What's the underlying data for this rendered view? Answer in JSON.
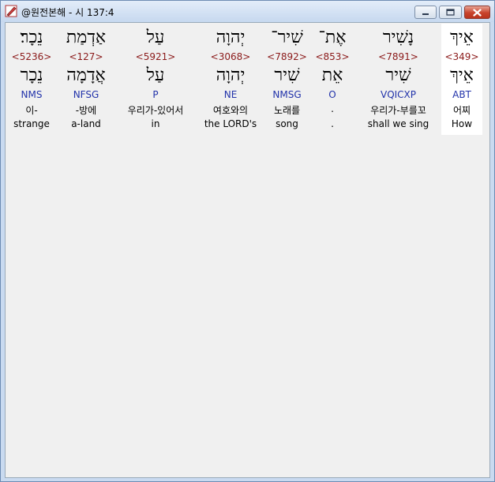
{
  "window": {
    "title": "@원전본해 - 시 137:4",
    "icon": "app-pen-icon"
  },
  "colors": {
    "strong": "#8b1a1a",
    "parse": "#2233aa",
    "selected_bg": "#ffffff",
    "panel_bg": "#f0f0f0"
  },
  "words": [
    {
      "hebrew": "נֵכָר׃",
      "strong": "<5236>",
      "lemma": "נֵכָר",
      "parse": "NMS",
      "korean": "이-",
      "english": "strange"
    },
    {
      "hebrew": "אַדְמַת",
      "strong": "<127>",
      "lemma": "אֲדָמָה",
      "parse": "NFSG",
      "korean": "-방에",
      "english": "a-land"
    },
    {
      "hebrew": "עַל",
      "strong": "<5921>",
      "lemma": "עַל",
      "parse": "P",
      "korean": "우리가-있어서",
      "english": "in"
    },
    {
      "hebrew": "יְהוָה",
      "strong": "<3068>",
      "lemma": "יְהוָה",
      "parse": "NE",
      "korean": "여호와의",
      "english": "the LORD's"
    },
    {
      "hebrew": "שִׁיר־",
      "strong": "<7892>",
      "lemma": "שִׁיר",
      "parse": "NMSG",
      "korean": "노래를",
      "english": "song"
    },
    {
      "hebrew": "אֶת־",
      "strong": "<853>",
      "lemma": "אֵת",
      "parse": "O",
      "korean": ".",
      "english": "."
    },
    {
      "hebrew": "נָשִׁיר",
      "strong": "<7891>",
      "lemma": "שִׁיר",
      "parse": "VQICXP",
      "korean": "우리가-부를꼬",
      "english": "shall we sing"
    },
    {
      "hebrew": "אֵיךְ",
      "strong": "<349>",
      "lemma": "אֵיךְ",
      "parse": "ABT",
      "korean": "어찌",
      "english": "How"
    }
  ]
}
